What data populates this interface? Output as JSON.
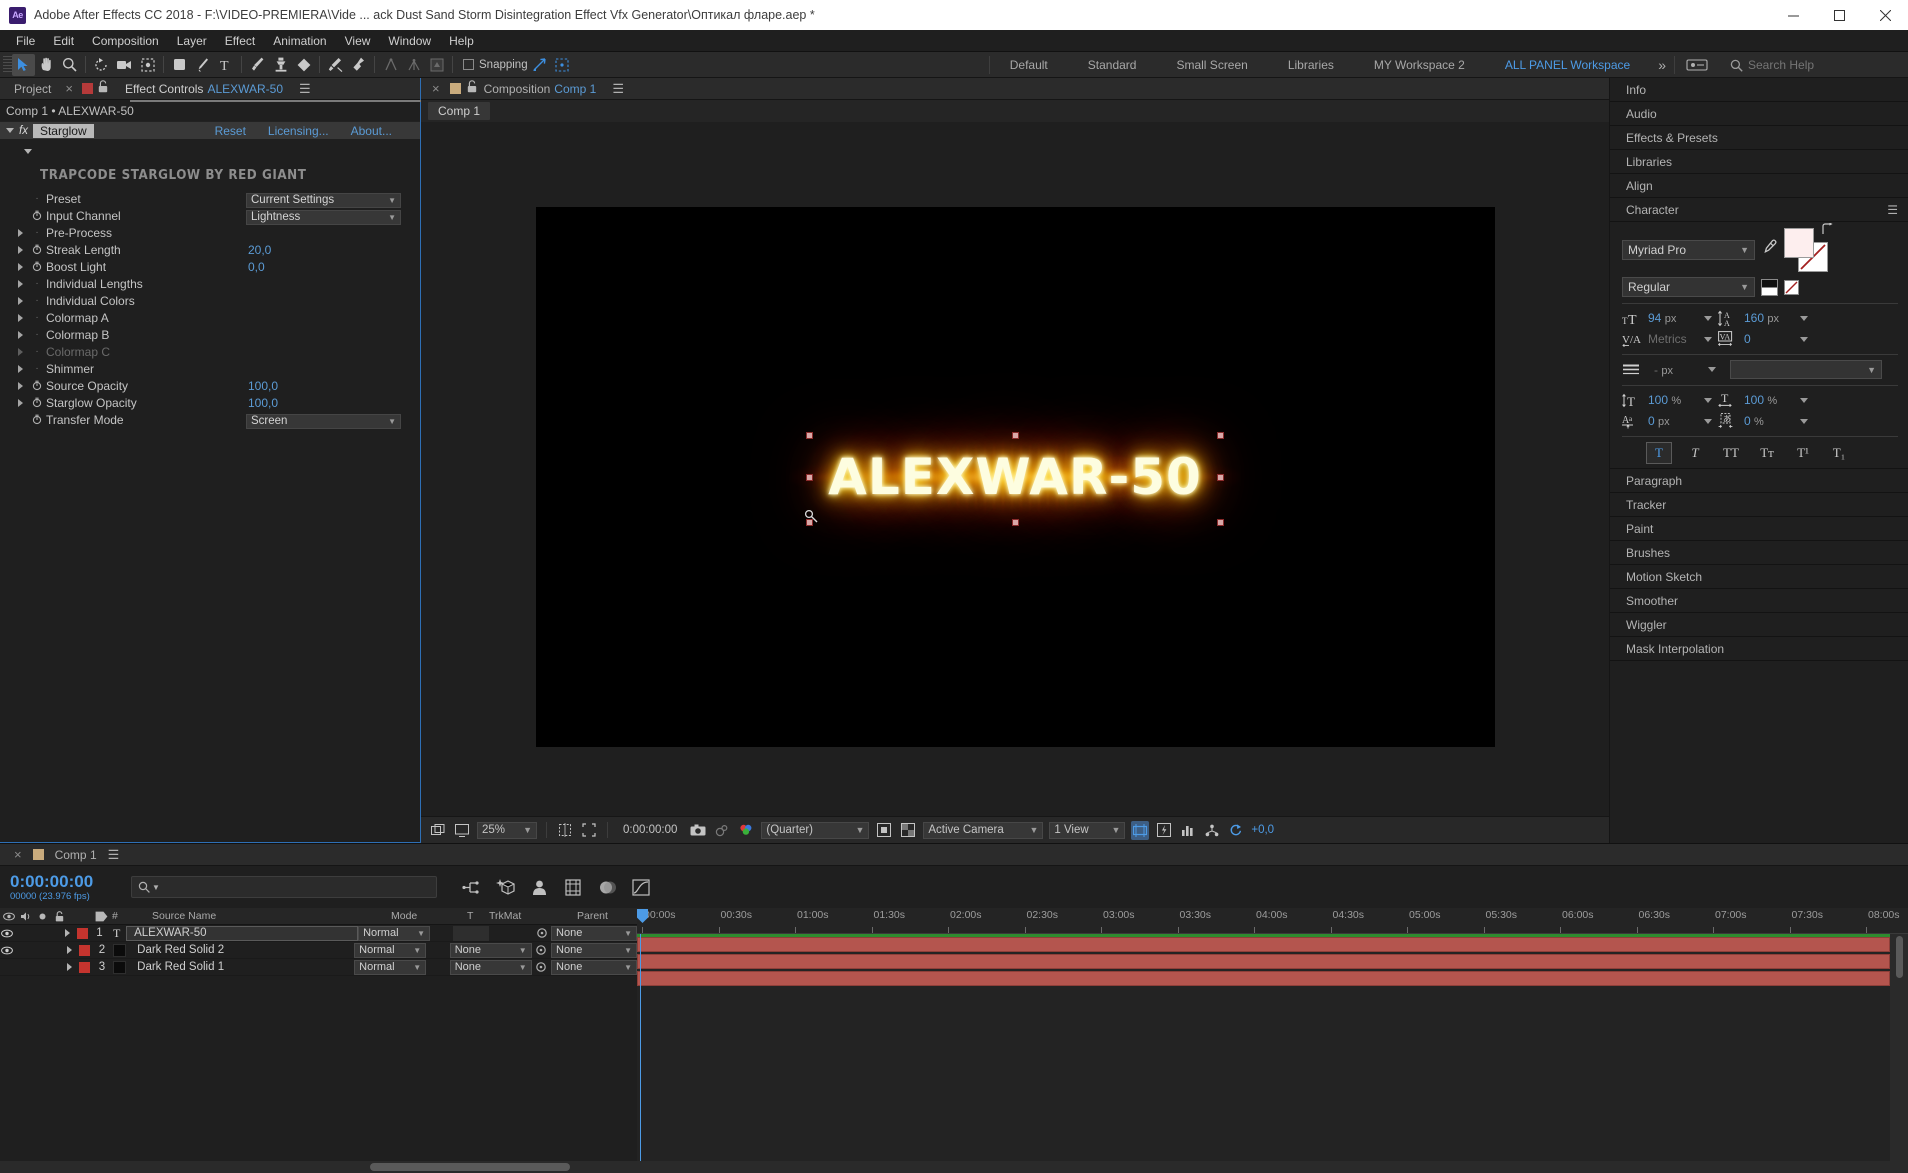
{
  "titlebar": {
    "app_badge": "Ae",
    "title": "Adobe After Effects CC 2018 - F:\\VIDEO-PREMIERA\\Vide ... ack Dust Sand Storm Disintegration Effect Vfx Generator\\Оптикал фларе.aep *",
    "minimize": "minimize-icon",
    "maximize": "maximize-icon",
    "close": "close-icon"
  },
  "menubar": {
    "items": [
      "File",
      "Edit",
      "Composition",
      "Layer",
      "Effect",
      "Animation",
      "View",
      "Window",
      "Help"
    ]
  },
  "toolbar": {
    "tools": [
      {
        "name": "selection-tool",
        "selected": true
      },
      {
        "name": "hand-tool",
        "selected": false
      },
      {
        "name": "zoom-tool",
        "selected": false
      },
      {
        "name": "rotation-tool",
        "selected": false
      },
      {
        "name": "camera-tool",
        "selected": false
      },
      {
        "name": "pan-behind-tool",
        "selected": false
      },
      {
        "name": "shape-tool",
        "selected": false
      },
      {
        "name": "pen-tool",
        "selected": false
      },
      {
        "name": "type-tool",
        "selected": false
      },
      {
        "name": "brush-tool",
        "selected": false
      },
      {
        "name": "clone-stamp-tool",
        "selected": false
      },
      {
        "name": "eraser-tool",
        "selected": false
      },
      {
        "name": "roto-brush-tool",
        "selected": false
      },
      {
        "name": "puppet-pin-tool",
        "selected": false
      }
    ],
    "snapping_label": "Snapping",
    "workspaces": [
      "Default",
      "Standard",
      "Small Screen",
      "Libraries",
      "MY Workspace 2"
    ],
    "active_workspace": "ALL PANEL Workspace",
    "search_placeholder": "Search Help"
  },
  "effect_controls": {
    "tab_project": "Project",
    "tab_title": "Effect Controls",
    "tab_layer": "ALEXWAR-50",
    "breadcrumb": "Comp 1 • ALEXWAR-50",
    "fx_label": "fx",
    "effect_name": "Starglow",
    "links": [
      "Reset",
      "Licensing...",
      "About..."
    ],
    "brand": "TRAPCODE STARGLOW BY RED GIANT",
    "params": [
      {
        "label": "Preset",
        "type": "select",
        "value": "Current Settings",
        "arrow": false,
        "stopwatch": false,
        "dim": false
      },
      {
        "label": "Input Channel",
        "type": "select",
        "value": "Lightness",
        "arrow": false,
        "stopwatch": true,
        "dim": false
      },
      {
        "label": "Pre-Process",
        "type": "group",
        "value": "",
        "arrow": true,
        "stopwatch": false,
        "dim": false
      },
      {
        "label": "Streak Length",
        "type": "number",
        "value": "20,0",
        "arrow": true,
        "stopwatch": true,
        "dim": false
      },
      {
        "label": "Boost Light",
        "type": "number",
        "value": "0,0",
        "arrow": true,
        "stopwatch": true,
        "dim": false
      },
      {
        "label": "Individual Lengths",
        "type": "group",
        "value": "",
        "arrow": true,
        "stopwatch": false,
        "dim": false
      },
      {
        "label": "Individual Colors",
        "type": "group",
        "value": "",
        "arrow": true,
        "stopwatch": false,
        "dim": false
      },
      {
        "label": "Colormap A",
        "type": "group",
        "value": "",
        "arrow": true,
        "stopwatch": false,
        "dim": false
      },
      {
        "label": "Colormap B",
        "type": "group",
        "value": "",
        "arrow": true,
        "stopwatch": false,
        "dim": false
      },
      {
        "label": "Colormap C",
        "type": "group",
        "value": "",
        "arrow": true,
        "stopwatch": false,
        "dim": true
      },
      {
        "label": "Shimmer",
        "type": "group",
        "value": "",
        "arrow": true,
        "stopwatch": false,
        "dim": false
      },
      {
        "label": "Source Opacity",
        "type": "number",
        "value": "100,0",
        "arrow": true,
        "stopwatch": true,
        "dim": false
      },
      {
        "label": "Starglow Opacity",
        "type": "number",
        "value": "100,0",
        "arrow": true,
        "stopwatch": true,
        "dim": false
      },
      {
        "label": "Transfer Mode",
        "type": "select",
        "value": "Screen",
        "arrow": false,
        "stopwatch": true,
        "dim": false
      }
    ]
  },
  "composition": {
    "tab_label": "Composition",
    "tab_name": "Comp 1",
    "sub_tab": "Comp 1",
    "canvas_text": "ALEXWAR-50",
    "viewer": {
      "zoom": "25%",
      "timecode": "0:00:00:00",
      "resolution": "(Quarter)",
      "camera": "Active Camera",
      "views": "1 View",
      "exposure": "+0,0"
    }
  },
  "right_panel": {
    "items_top": [
      "Info",
      "Audio",
      "Effects & Presets",
      "Libraries",
      "Align"
    ],
    "character": {
      "title": "Character",
      "font_family": "Myriad Pro",
      "font_style": "Regular",
      "font_size": "94",
      "font_size_unit": "px",
      "leading": "160",
      "leading_unit": "px",
      "kerning": "Metrics",
      "tracking": "0",
      "stroke_width": "-",
      "stroke_width_unit": "px",
      "stroke_type": "",
      "vertical_scale": "100",
      "vertical_scale_unit": "%",
      "horizontal_scale": "100",
      "horizontal_scale_unit": "%",
      "baseline_shift": "0",
      "baseline_shift_unit": "px",
      "tsume": "0",
      "tsume_unit": "%",
      "styles": [
        "T",
        "T",
        "TT",
        "Tт",
        "T¹",
        "T₁"
      ],
      "active_style": 0
    },
    "items_bottom": [
      "Paragraph",
      "Tracker",
      "Paint",
      "Brushes",
      "Motion Sketch",
      "Smoother",
      "Wiggler",
      "Mask Interpolation"
    ]
  },
  "timeline": {
    "tab_name": "Comp 1",
    "current_time": "0:00:00:00",
    "frame_info": "00000 (23.976 fps)",
    "search_placeholder": "",
    "columns": [
      "#",
      "Source Name",
      "Mode",
      "T",
      "TrkMat",
      "Parent"
    ],
    "ruler_ticks": [
      "00:00s",
      "00:30s",
      "01:00s",
      "01:30s",
      "02:00s",
      "02:30s",
      "03:00s",
      "03:30s",
      "04:00s",
      "04:30s",
      "05:00s",
      "05:30s",
      "06:00s",
      "06:30s",
      "07:00s",
      "07:30s",
      "08:00s"
    ],
    "layers": [
      {
        "index": "1",
        "type": "T",
        "name": "ALEXWAR-50",
        "mode": "Normal",
        "trkmat": "",
        "parent": "None",
        "visible": true,
        "selected": true
      },
      {
        "index": "2",
        "type": "solid",
        "name": "Dark Red Solid 2",
        "mode": "Normal",
        "trkmat": "None",
        "parent": "None",
        "visible": true,
        "selected": false
      },
      {
        "index": "3",
        "type": "solid",
        "name": "Dark Red Solid 1",
        "mode": "Normal",
        "trkmat": "None",
        "parent": "None",
        "visible": false,
        "selected": false
      }
    ]
  },
  "colors": {
    "accent_blue": "#4d9be6",
    "link_blue": "#5b9bd5",
    "layer_red": "#b4554e",
    "panel_bg": "#1f1f1f"
  }
}
